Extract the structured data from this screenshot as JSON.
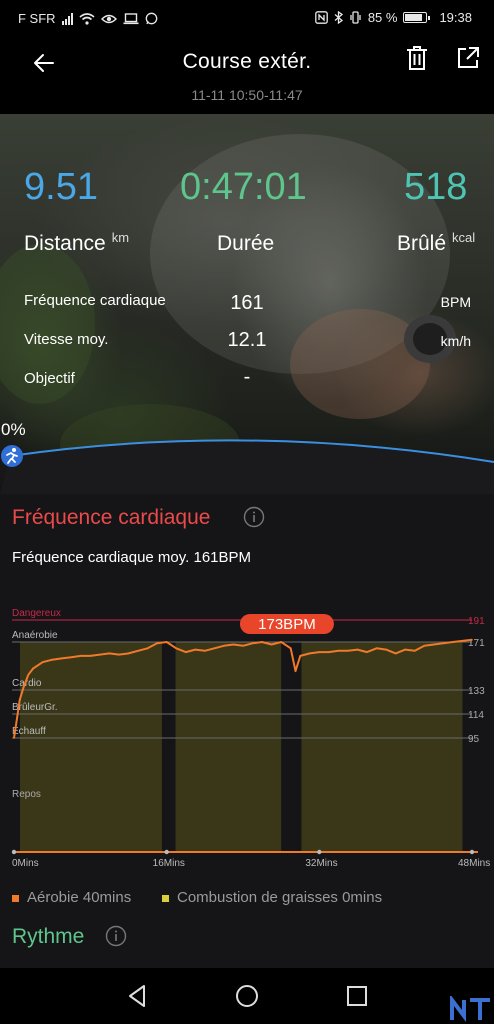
{
  "status_bar": {
    "carrier": "F SFR",
    "battery": "85 %",
    "battery_level": 0.85,
    "time": "19:38"
  },
  "header": {
    "title": "Course extér.",
    "subtitle": "11-11 10:50-11:47"
  },
  "summary": {
    "distance": {
      "value": "9.51",
      "label": "Distance",
      "unit": "km",
      "color": "#4aa8e8"
    },
    "duration": {
      "value": "0:47:01",
      "label": "Durée",
      "color": "#5ec58c"
    },
    "burned": {
      "value": "518",
      "label": "Brûlé",
      "unit": "kcal",
      "color": "#4ec5b3"
    },
    "rows": [
      {
        "label": "Fréquence cardiaque",
        "value": "161",
        "unit": "BPM"
      },
      {
        "label": "Vitesse moy.",
        "value": "12.1",
        "unit": "km/h"
      },
      {
        "label": "Objectif",
        "value": "-",
        "unit": ""
      }
    ],
    "progress_label": "0%",
    "progress": 0
  },
  "heart_rate": {
    "title": "Fréquence cardiaque",
    "title_color": "#ea4a4a",
    "average_text": "Fréquence cardiaque moy. 161BPM",
    "legend": [
      {
        "label": "Aérobie 40mins",
        "color": "#f07a2a"
      },
      {
        "label": "Combustion de graisses 0mins",
        "color": "#d9cf3a"
      }
    ]
  },
  "rythme": {
    "title": "Rythme",
    "color": "#5ec58c"
  },
  "chart_data": {
    "type": "line",
    "title": "Fréquence cardiaque",
    "xlabel": "",
    "ylabel": "",
    "x_ticks": [
      "0Mins",
      "16Mins",
      "32Mins",
      "48Mins"
    ],
    "xlim": [
      0,
      48
    ],
    "zones": [
      {
        "name": "Dangereux",
        "value": 191
      },
      {
        "name": "Anaérobie",
        "value": 171
      },
      {
        "name": "Cardio",
        "value": 133
      },
      {
        "name": "BrûleurGr.",
        "value": 114
      },
      {
        "name": "Échauff",
        "value": 95
      },
      {
        "name": "Repos",
        "value": null
      }
    ],
    "y_ticks": [
      "191",
      "171",
      "133",
      "114",
      "95"
    ],
    "peak_label": "173BPM",
    "peak_x": 28.5,
    "segments": [
      [
        0,
        15.5
      ],
      [
        16.3,
        28
      ],
      [
        29.5,
        47
      ]
    ],
    "series": [
      {
        "x": [
          0,
          0.3,
          0.6,
          1,
          1.5,
          2,
          3,
          4,
          5,
          6,
          7,
          8,
          9,
          10,
          11,
          12,
          13,
          14,
          15,
          16,
          17,
          18,
          19,
          20,
          21,
          22,
          23,
          24,
          25,
          26,
          27,
          28,
          29,
          29.5,
          30,
          31,
          32,
          33,
          34,
          35,
          36,
          37,
          38,
          39,
          40,
          41,
          42,
          43,
          44,
          45,
          46,
          47,
          48
        ],
        "y": [
          95,
          110,
          125,
          135,
          145,
          150,
          155,
          157,
          158,
          159,
          160,
          160,
          161,
          162,
          161,
          162,
          164,
          166,
          170,
          171,
          166,
          163,
          165,
          164,
          166,
          168,
          169,
          168,
          170,
          171,
          169,
          171,
          166,
          148,
          160,
          162,
          163,
          163,
          164,
          164,
          165,
          163,
          166,
          165,
          162,
          165,
          164,
          168,
          169,
          170,
          171,
          172,
          173
        ]
      }
    ]
  }
}
